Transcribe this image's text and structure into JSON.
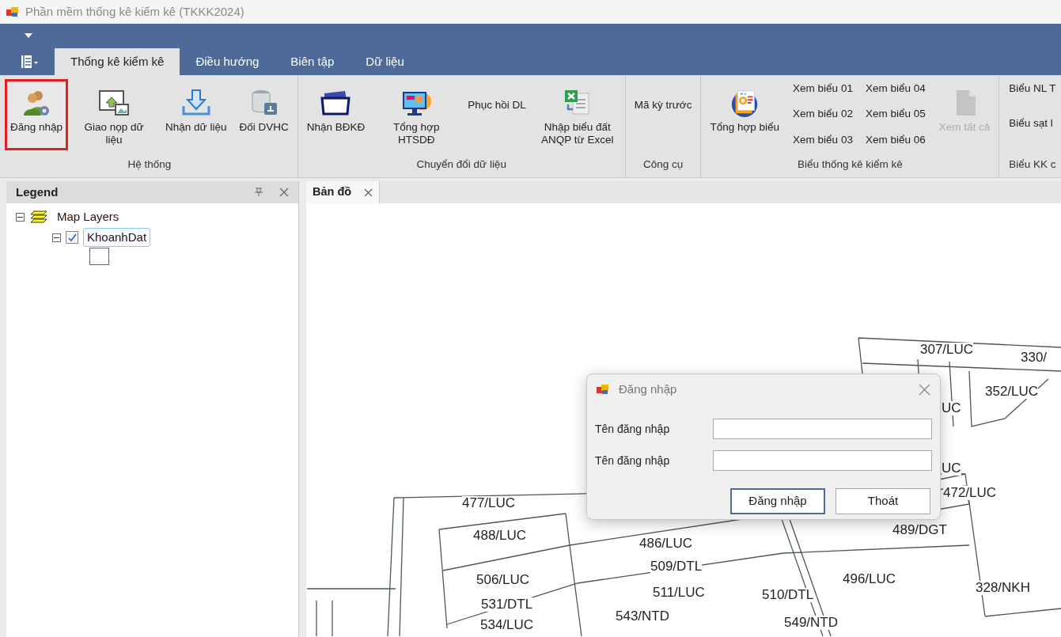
{
  "window": {
    "title": "Phần mềm thống kê kiểm kê (TKKK2024)"
  },
  "ribbon": {
    "tabs": [
      {
        "label": "Thống kê kiểm kê",
        "selected": true
      },
      {
        "label": "Điều hướng",
        "selected": false
      },
      {
        "label": "Biên tập",
        "selected": false
      },
      {
        "label": "Dữ liệu",
        "selected": false
      }
    ],
    "groups": [
      {
        "label": "Hệ thống",
        "items": [
          {
            "kind": "large",
            "label": "Đăng nhập",
            "highlighted": true,
            "disabled": false
          },
          {
            "kind": "large",
            "label": "Giao nọp dữ liệu",
            "highlighted": false,
            "disabled": false
          },
          {
            "kind": "large",
            "label": "Nhận dữ liệu",
            "highlighted": false,
            "disabled": false
          },
          {
            "kind": "large",
            "label": "Đối DVHC",
            "highlighted": false,
            "disabled": false
          }
        ]
      },
      {
        "label": "Chuyển đổi dữ liệu",
        "items": [
          {
            "kind": "large",
            "label": "Nhận BĐKĐ",
            "highlighted": false,
            "disabled": false
          },
          {
            "kind": "large",
            "label": "Tổng hợp HTSDĐ",
            "highlighted": false,
            "disabled": false
          },
          {
            "kind": "text",
            "label": "Phục hồi DL",
            "highlighted": false,
            "disabled": false
          },
          {
            "kind": "large",
            "label": "Nhập biểu đất ANQP từ Excel",
            "highlighted": false,
            "disabled": false
          }
        ]
      },
      {
        "label": "Công cụ",
        "items": [
          {
            "kind": "text",
            "label": "Mã kỳ trước",
            "highlighted": false,
            "disabled": false
          }
        ]
      },
      {
        "label": "Biểu thống kê kiểm kê",
        "items": [
          {
            "kind": "large",
            "label": "Tổng hợp biểu",
            "highlighted": false,
            "disabled": false
          },
          {
            "kind": "small",
            "label": "Xem biểu 01",
            "highlighted": false,
            "disabled": false
          },
          {
            "kind": "small",
            "label": "Xem biểu 02",
            "highlighted": false,
            "disabled": false
          },
          {
            "kind": "small",
            "label": "Xem biểu 03",
            "highlighted": false,
            "disabled": false
          },
          {
            "kind": "small",
            "label": "Xem biểu 04",
            "highlighted": false,
            "disabled": false
          },
          {
            "kind": "small",
            "label": "Xem biểu 05",
            "highlighted": false,
            "disabled": false
          },
          {
            "kind": "small",
            "label": "Xem biểu 06",
            "highlighted": false,
            "disabled": false
          },
          {
            "kind": "large",
            "label": "Xem tất cả",
            "highlighted": false,
            "disabled": true
          }
        ]
      },
      {
        "label": "Biểu KK c",
        "items": [
          {
            "kind": "small",
            "label": "Biểu NL T",
            "highlighted": false,
            "disabled": false
          },
          {
            "kind": "small",
            "label": "Biểu sạt l",
            "highlighted": false,
            "disabled": false
          }
        ]
      }
    ]
  },
  "legend": {
    "title": "Legend",
    "tree": [
      {
        "label": "Map Layers",
        "expanded": true,
        "children": [
          {
            "label": "KhoanhDat",
            "expanded": true,
            "checked": true,
            "selected": true
          }
        ]
      }
    ]
  },
  "map": {
    "tabs": [
      {
        "label": "Bản đồ",
        "selected": true
      }
    ],
    "parcel_labels": [
      "307/LUC",
      "330/",
      "352/LUC",
      "UC",
      "UC",
      "472/LUC",
      "477/LUC",
      "488/LUC",
      "486/LUC",
      "489/DGT",
      "509/DTL",
      "496/LUC",
      "506/LUC",
      "511/LUC",
      "510/DTL",
      "328/NKH",
      "531/DTL",
      "543/NTD",
      "534/LUC",
      "549/NTD"
    ]
  },
  "dialog": {
    "title": "Đăng nhập",
    "fields": [
      {
        "label": "Tên đăng nhập"
      },
      {
        "label": "Tên đăng nhập"
      }
    ],
    "buttons": [
      {
        "label": "Đăng nhập",
        "default": true
      },
      {
        "label": "Thoát",
        "default": false
      }
    ]
  }
}
